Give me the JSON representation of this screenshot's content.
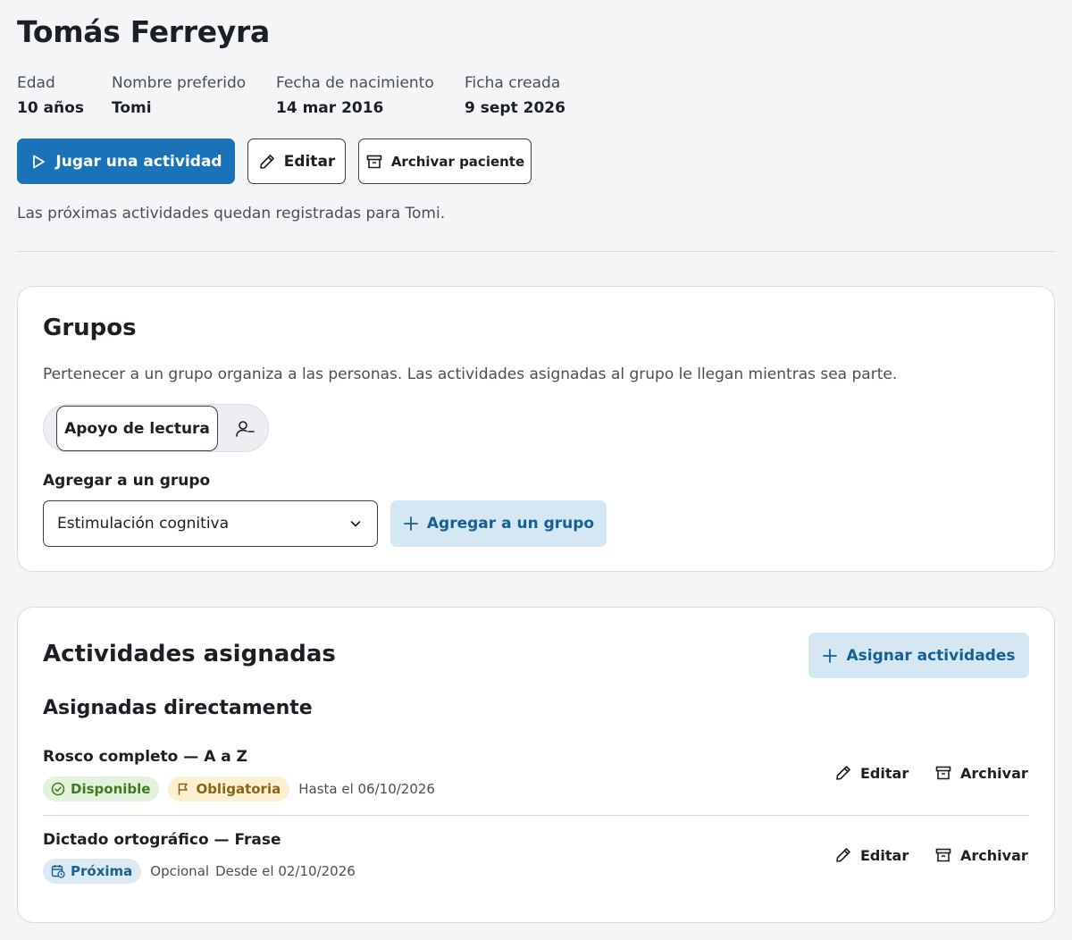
{
  "patient": {
    "name": "Tomás Ferreyra",
    "meta": [
      {
        "label": "Edad",
        "value": "10 años"
      },
      {
        "label": "Nombre preferido",
        "value": "Tomi"
      },
      {
        "label": "Fecha de nacimiento",
        "value": "14 mar 2016"
      },
      {
        "label": "Ficha creada",
        "value": "9 sept 2026"
      }
    ]
  },
  "actions": {
    "play_label": "Jugar una actividad",
    "edit_label": "Editar",
    "archive_label": "Archivar paciente"
  },
  "note": "Las próximas actividades quedan registradas para Tomi.",
  "groups": {
    "title": "Grupos",
    "description": "Pertenecer a un grupo organiza a las personas. Las actividades asignadas al grupo le llegan mientras sea parte.",
    "current": [
      {
        "label": "Apoyo de lectura"
      }
    ],
    "add_label": "Agregar a un grupo",
    "select_value": "Estimulación cognitiva",
    "add_button_label": "Agregar a un grupo"
  },
  "activities": {
    "title": "Actividades asignadas",
    "assign_button_label": "Asignar actividades",
    "subtitle": "Asignadas directamente",
    "items": [
      {
        "title": "Rosco completo — A a Z",
        "status": "Disponible",
        "requirement": "Obligatoria",
        "date_text": "Hasta el 06/10/2026",
        "edit_label": "Editar",
        "archive_label": "Archivar"
      },
      {
        "title": "Dictado ortográfico — Frase",
        "status": "Próxima",
        "requirement": "Opcional",
        "date_text": "Desde el 02/10/2026",
        "edit_label": "Editar",
        "archive_label": "Archivar"
      }
    ]
  },
  "colors": {
    "primary": "#1a73b8",
    "soft_primary": "#d6e7f4",
    "available": "#3f7a1f",
    "required": "#8a6510",
    "upcoming": "#1a5f93"
  },
  "icons": [
    "play-icon",
    "pencil-icon",
    "archive-box-icon",
    "user-remove-icon",
    "chevron-down-icon",
    "plus-icon",
    "check-circle-icon",
    "flag-icon",
    "calendar-clock-icon"
  ]
}
